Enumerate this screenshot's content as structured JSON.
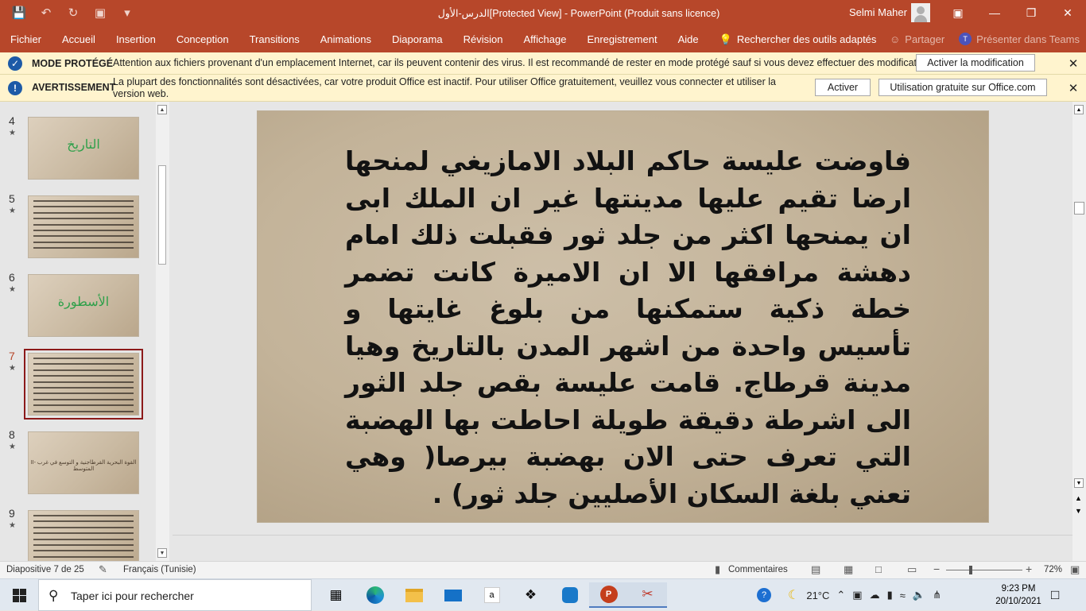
{
  "titlebar": {
    "title": "الدرس-الأول[Protected View]  -  PowerPoint (Produit sans licence)",
    "user": "Selmi Maher",
    "quick_access": [
      "save-icon",
      "undo-icon",
      "redo-icon",
      "present-icon",
      "customize-icon"
    ],
    "window_buttons": [
      "ribbon-display-icon",
      "minimize-icon",
      "restore-icon",
      "close-icon"
    ]
  },
  "ribbon": {
    "tabs": [
      "Fichier",
      "Accueil",
      "Insertion",
      "Conception",
      "Transitions",
      "Animations",
      "Diaporama",
      "Révision",
      "Affichage",
      "Enregistrement",
      "Aide"
    ],
    "search_label": "Rechercher des outils adaptés",
    "share_label": "Partager",
    "teams_label": "Présenter dans Teams"
  },
  "protected_bar": {
    "label": "MODE PROTÉGÉ",
    "text": "Attention aux fichiers provenant d'un emplacement Internet, car ils peuvent contenir des virus. Il est recommandé de rester en mode protégé sauf si vous devez effectuer des modifications.",
    "button": "Activer la modification"
  },
  "warning_bar": {
    "label": "AVERTISSEMENT",
    "text": "La plupart des fonctionnalités sont désactivées, car votre produit Office est inactif. Pour utiliser Office gratuitement, veuillez vous connecter et utiliser la version web.",
    "activate_button": "Activer",
    "free_button": "Utilisation gratuite sur Office.com"
  },
  "thumbnails": [
    {
      "num": "4",
      "kind": "title",
      "text": "التاريخ"
    },
    {
      "num": "5",
      "kind": "lines",
      "lines": 9
    },
    {
      "num": "6",
      "kind": "title",
      "text": "الأسطورة"
    },
    {
      "num": "7",
      "kind": "lines",
      "lines": 10,
      "active": true
    },
    {
      "num": "8",
      "kind": "mid",
      "text": "II- القوة البحرية القرطاجنية و التوسع في غرب المتوسط"
    },
    {
      "num": "9",
      "kind": "lines",
      "lines": 8
    }
  ],
  "slide": {
    "body": "فاوضت عليسة حاكم البلاد الامازيغي لمنحها ارضا تقيم عليها مدينتها غير ان الملك ابى ان يمنحها اكثر من جلد ثور فقبلت ذلك امام دهشة مرافقها الا ان الاميرة كانت تضمر خطة ذكية ستمكنها من بلوغ غايتها و تأسيس واحدة من اشهر المدن بالتاريخ وهيا مدينة قرطاج. قامت عليسة بقص جلد الثور الى اشرطة دقيقة طويلة احاطت بها الهضبة التي تعرف حتى الان بهضبة بيرصا( وهي تعني بلغة السكان الأصليين جلد ثور) ."
  },
  "statusbar": {
    "slide_counter": "Diapositive 7 de 25",
    "language": "Français (Tunisie)",
    "comments": "Commentaires",
    "zoom": "72%"
  },
  "taskbar": {
    "search_placeholder": "Taper ici pour rechercher",
    "apps": [
      "task-view-icon",
      "edge-icon",
      "file-explorer-icon",
      "mail-icon",
      "amazon-icon",
      "dropbox-icon",
      "app-icon",
      "powerpoint-icon",
      "snip-icon"
    ],
    "temperature": "21°C",
    "time": "9:23 PM",
    "date": "20/10/2021"
  }
}
